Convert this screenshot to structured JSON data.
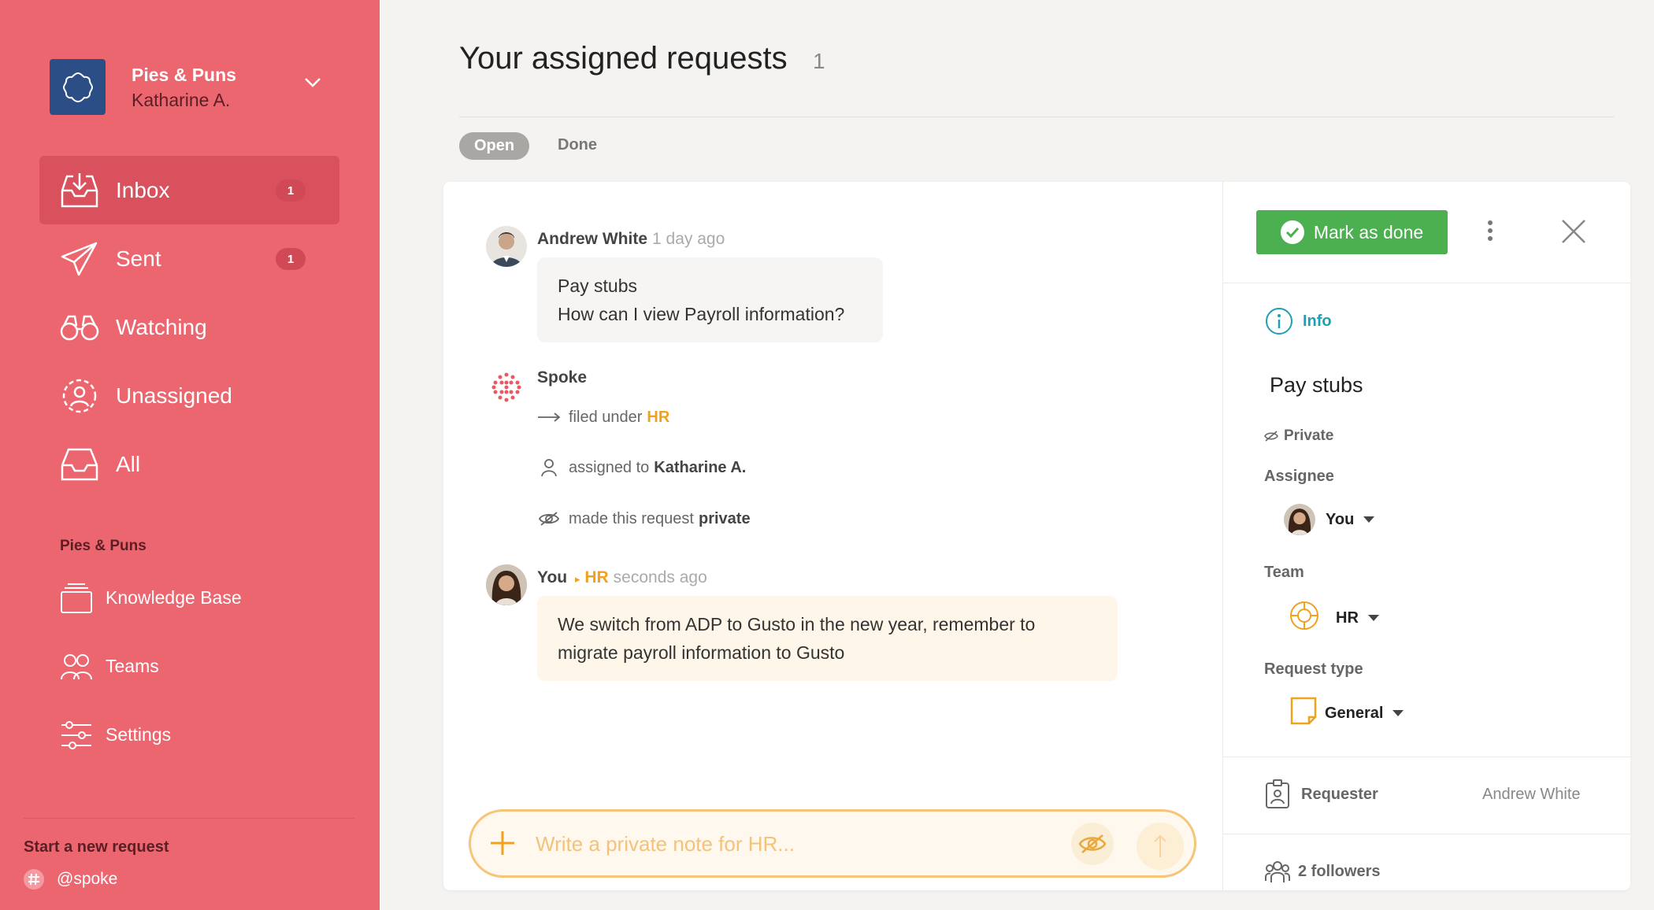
{
  "sidebar": {
    "org_name": "Pies & Puns",
    "org_user": "Katharine A.",
    "nav": [
      {
        "label": "Inbox",
        "badge": "1",
        "icon": "inbox-icon",
        "active": true
      },
      {
        "label": "Sent",
        "badge": "1",
        "icon": "paper-plane-icon"
      },
      {
        "label": "Watching",
        "icon": "binoculars-icon"
      },
      {
        "label": "Unassigned",
        "icon": "unassigned-user-icon"
      },
      {
        "label": "All",
        "icon": "tray-icon"
      }
    ],
    "section_title": "Pies & Puns",
    "section_items": [
      {
        "label": "Knowledge Base",
        "icon": "book-icon"
      },
      {
        "label": "Teams",
        "icon": "people-icon"
      },
      {
        "label": "Settings",
        "icon": "sliders-icon"
      }
    ],
    "start_title": "Start a new request",
    "spoke_handle": "@spoke"
  },
  "main": {
    "title": "Your assigned requests",
    "count": "1",
    "tabs": {
      "open": "Open",
      "done": "Done"
    }
  },
  "conversation": {
    "msg1": {
      "author": "Andrew White",
      "time": "1 day ago",
      "line1": "Pay stubs",
      "line2": "How can I view Payroll information?"
    },
    "spoke": {
      "author": "Spoke"
    },
    "events": [
      {
        "text": "filed under",
        "value": "HR"
      },
      {
        "text": "assigned to",
        "value": "Katharine A."
      },
      {
        "text": "made this request",
        "value": "private"
      }
    ],
    "msg2": {
      "author": "You",
      "team": "HR",
      "time": "seconds ago",
      "line1": "We switch from ADP to Gusto in the new year, remember to",
      "line2": "migrate payroll information to Gusto"
    },
    "composer_placeholder": "Write a private note for HR..."
  },
  "panel": {
    "mark_done": "Mark as done",
    "info": "Info",
    "title": "Pay stubs",
    "private": "Private",
    "assignee_label": "Assignee",
    "assignee_value": "You",
    "team_label": "Team",
    "team_value": "HR",
    "type_label": "Request type",
    "type_value": "General",
    "requester_label": "Requester",
    "requester_value": "Andrew White",
    "followers": "2 followers"
  },
  "colors": {
    "sidebar": "#ec6670",
    "accent_orange": "#f0a21e",
    "success": "#4caf50",
    "info": "#1ba1b5"
  }
}
